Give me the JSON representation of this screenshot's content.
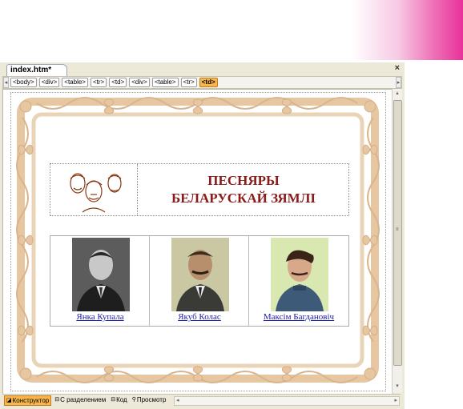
{
  "document": {
    "tab_label": "index.htm*",
    "close_label": "×"
  },
  "tag_selector": {
    "tags": [
      "<body>",
      "<div>",
      "<table>",
      "<tr>",
      "<td>",
      "<div>",
      "<table>",
      "<tr>",
      "<td>"
    ],
    "active_index": 8
  },
  "page": {
    "title_line1": "ПЕСНЯРЫ",
    "title_line2": "БЕЛАРУСКАЙ ЗЯМЛІ",
    "poets": [
      {
        "name": "Янка Купала"
      },
      {
        "name": "Якуб Колас"
      },
      {
        "name": "Максім Багдановіч"
      }
    ]
  },
  "view_modes": [
    {
      "label": "Конструктор",
      "icon": "design-view-icon",
      "active": true
    },
    {
      "label": "С разделением",
      "icon": "split-view-icon",
      "active": false
    },
    {
      "label": "Код",
      "icon": "code-view-icon",
      "active": false
    },
    {
      "label": "Просмотр",
      "icon": "preview-icon",
      "active": false
    }
  ],
  "colors": {
    "accent_pink": "#e8329b",
    "active_tag": "#f8b64c",
    "title_text": "#8b1a1a",
    "link": "#1a1aa6",
    "ornament": "#e6c7a2"
  }
}
